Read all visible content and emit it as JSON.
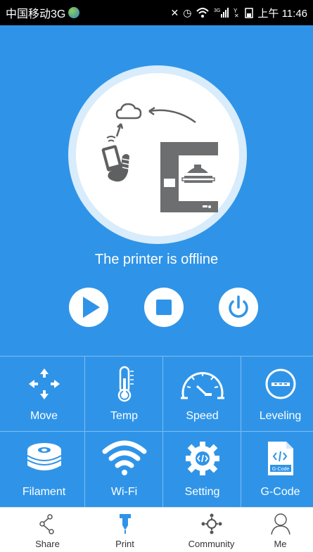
{
  "status_bar": {
    "carrier": "中国移动3G",
    "time": "上午 11:46",
    "network_small": "3G"
  },
  "printer": {
    "status": "The printer is offline"
  },
  "controls": [
    {
      "name": "play",
      "icon": "play-icon"
    },
    {
      "name": "stop",
      "icon": "stop-icon"
    },
    {
      "name": "power",
      "icon": "power-icon"
    }
  ],
  "grid": [
    {
      "label": "Move",
      "icon": "move-arrows-icon"
    },
    {
      "label": "Temp",
      "icon": "thermometer-icon"
    },
    {
      "label": "Speed",
      "icon": "speedometer-icon"
    },
    {
      "label": "Leveling",
      "icon": "leveling-icon"
    },
    {
      "label": "Filament",
      "icon": "filament-spool-icon"
    },
    {
      "label": "Wi-Fi",
      "icon": "wifi-icon"
    },
    {
      "label": "Setting",
      "icon": "gear-code-icon"
    },
    {
      "label": "G-Code",
      "icon": "gcode-file-icon"
    }
  ],
  "gcode_file_text": "G-Code",
  "tabs": [
    {
      "label": "Share",
      "icon": "share-icon",
      "active": false
    },
    {
      "label": "Print",
      "icon": "print-icon",
      "active": true
    },
    {
      "label": "Community",
      "icon": "community-icon",
      "active": false
    },
    {
      "label": "Me",
      "icon": "person-icon",
      "active": false
    }
  ],
  "colors": {
    "primary": "#2f94e8",
    "active_tab": "#2f94e8",
    "illustration": "#6d6e70"
  }
}
